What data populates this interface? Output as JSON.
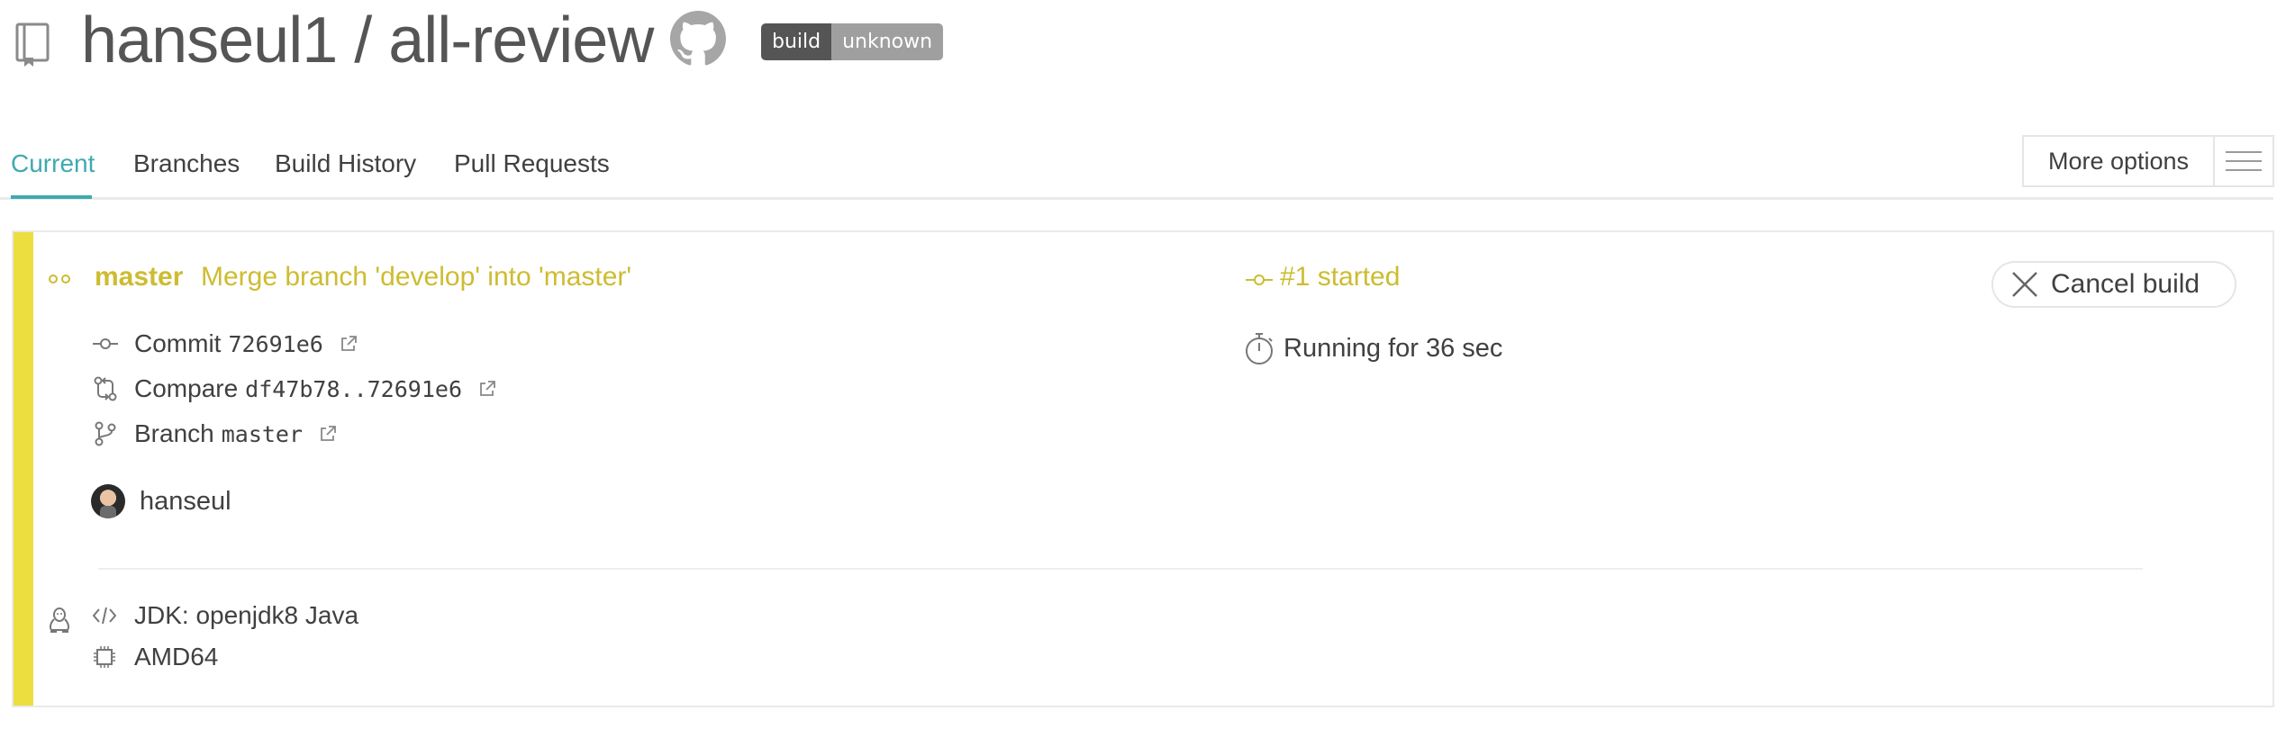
{
  "header": {
    "repo_title": "hanseul1 / all-review",
    "badge": {
      "left": "build",
      "right": "unknown"
    }
  },
  "tabs": [
    {
      "label": "Current",
      "active": true
    },
    {
      "label": "Branches",
      "active": false
    },
    {
      "label": "Build History",
      "active": false
    },
    {
      "label": "Pull Requests",
      "active": false
    }
  ],
  "more_options": {
    "label": "More options"
  },
  "build": {
    "branch": "master",
    "commit_message": "Merge branch 'develop' into 'master'",
    "state": "#1 started",
    "cancel_label": "Cancel build",
    "commit": {
      "label": "Commit",
      "value": "72691e6"
    },
    "compare": {
      "label": "Compare",
      "value": "df47b78..72691e6"
    },
    "branch_link": {
      "label": "Branch",
      "value": "master"
    },
    "running": "Running for 36 sec",
    "author": "hanseul",
    "jdk": "JDK: openjdk8 Java",
    "arch": "AMD64"
  },
  "colors": {
    "accent": "#3eaaaf",
    "started": "#cdbc31",
    "stripe": "#edde3f",
    "badge_left": "#555555",
    "badge_right": "#9f9f9f"
  },
  "icons": {
    "repo": "repo-book-icon",
    "github": "github-icon",
    "commit": "commit-icon",
    "compare": "compare-icon",
    "branch": "branch-icon",
    "external": "external-link-icon",
    "timer": "stopwatch-icon",
    "linux": "linux-tux-icon",
    "code": "code-icon",
    "cpu": "cpu-chip-icon",
    "cancel": "close-icon"
  }
}
